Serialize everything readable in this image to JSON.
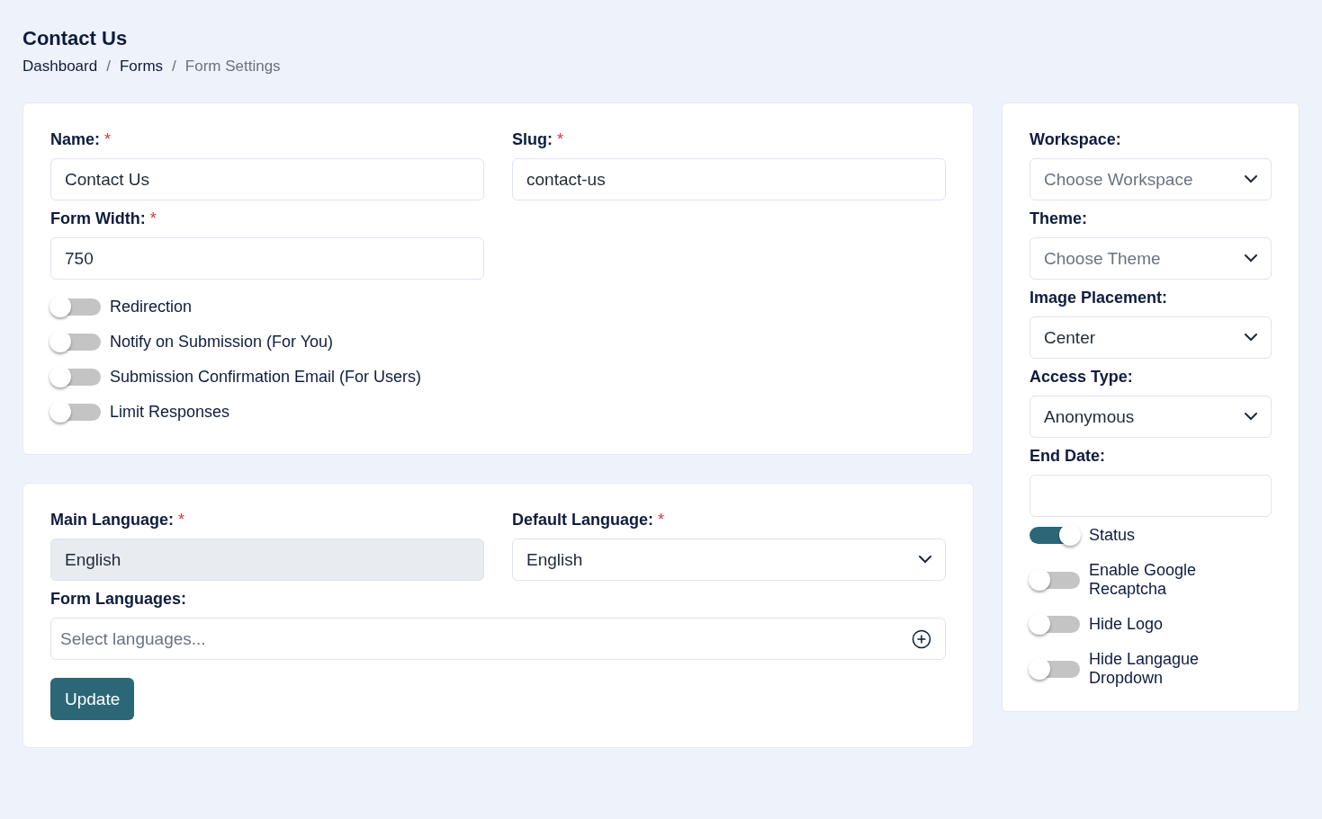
{
  "page": {
    "title": "Contact Us",
    "breadcrumbs": [
      {
        "label": "Dashboard",
        "current": false
      },
      {
        "label": "Forms",
        "current": false
      },
      {
        "label": "Form Settings",
        "current": true
      }
    ],
    "separator": "/"
  },
  "general_card": {
    "fields": [
      {
        "kind": "text",
        "label": "Name:",
        "required_mark": "*",
        "value": "Contact Us"
      },
      {
        "kind": "text",
        "label": "Slug:",
        "required_mark": "*",
        "value": "contact-us"
      },
      {
        "kind": "text",
        "label": "Form Width:",
        "required_mark": "*",
        "value": "750"
      }
    ],
    "toggles": [
      {
        "label": "Redirection",
        "on": false
      },
      {
        "label": "Notify on Submission (For You)",
        "on": false
      },
      {
        "label": "Submission Confirmation Email (For Users)",
        "on": false
      },
      {
        "label": "Limit Responses",
        "on": false
      }
    ]
  },
  "language_card": {
    "fields": [
      {
        "kind": "disabled",
        "label": "Main Language:",
        "required_mark": "*",
        "value": "English"
      },
      {
        "kind": "select",
        "label": "Default Language:",
        "required_mark": "*",
        "value": "English"
      }
    ],
    "form_languages": {
      "label": "Form Languages:",
      "placeholder": "Select languages..."
    },
    "button": "Update"
  },
  "sidebar": {
    "fields": [
      {
        "kind": "select",
        "label": "Workspace:",
        "placeholder": "Choose Workspace"
      },
      {
        "kind": "select",
        "label": "Theme:",
        "placeholder": "Choose Theme"
      },
      {
        "kind": "select",
        "label": "Image Placement:",
        "value": "Center"
      },
      {
        "kind": "select",
        "label": "Access Type:",
        "value": "Anonymous"
      },
      {
        "kind": "text",
        "label": "End Date:"
      }
    ],
    "toggles": [
      {
        "label": "Status",
        "on": true
      },
      {
        "label": "Enable Google Recaptcha",
        "on": false
      },
      {
        "label": "Hide Logo",
        "on": false
      },
      {
        "label": "Hide Langague Dropdown",
        "on": false
      }
    ]
  }
}
